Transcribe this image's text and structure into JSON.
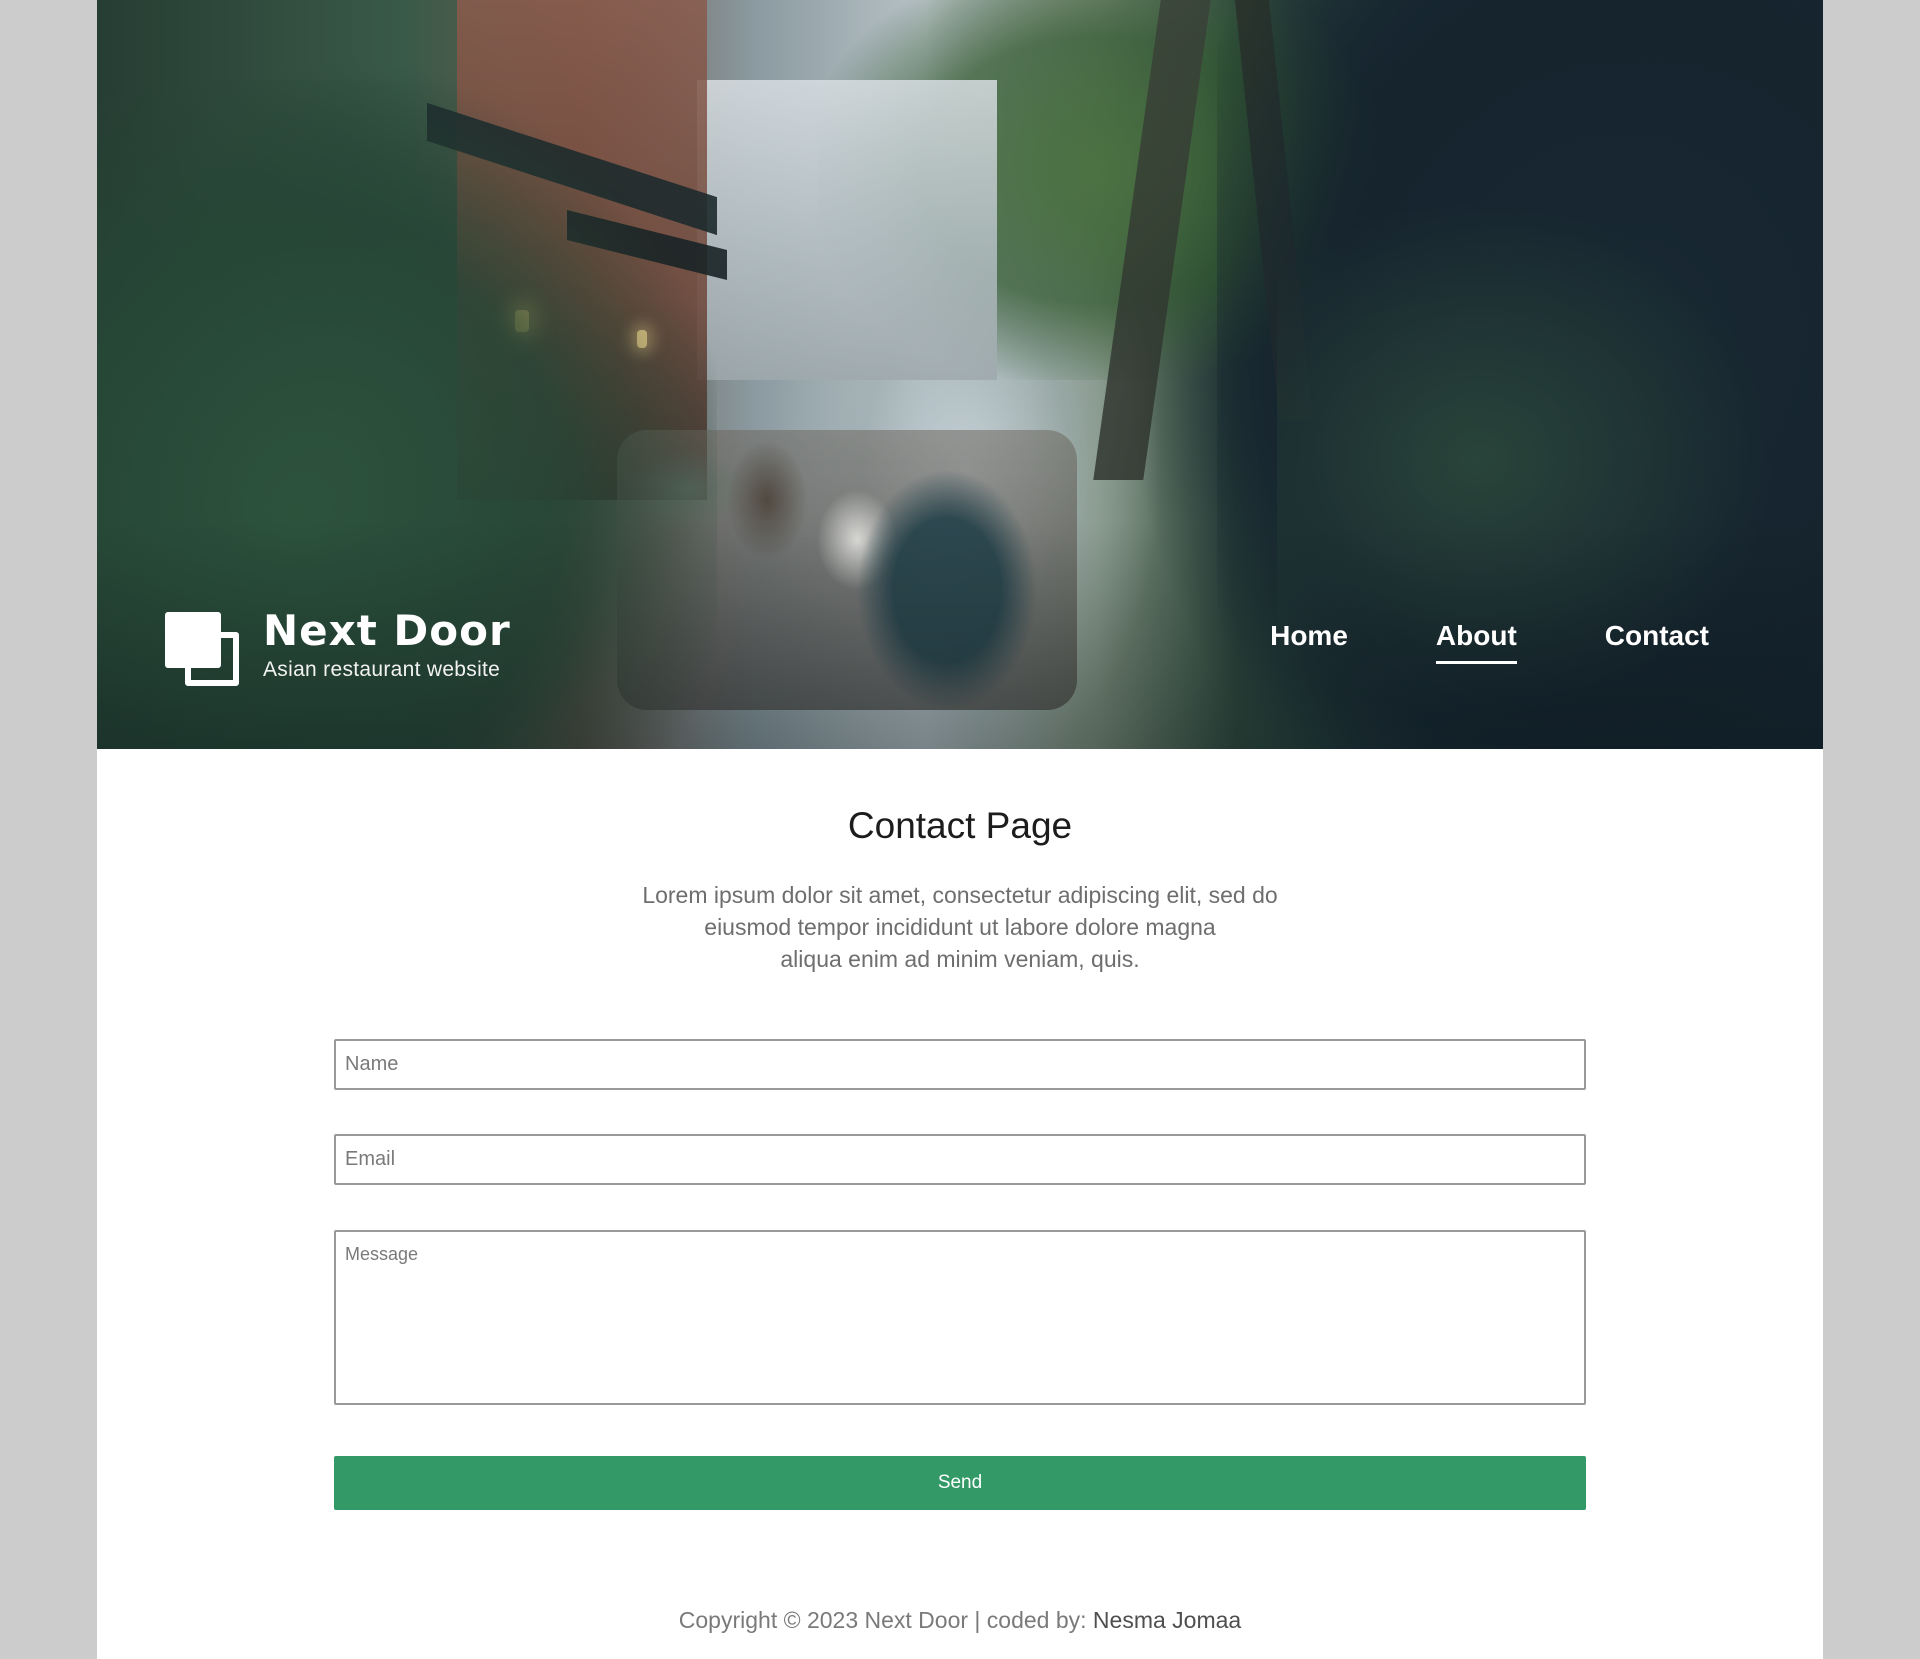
{
  "brand": {
    "title": "Next Door",
    "subtitle": "Asian restaurant website",
    "logo_icon": "overlapping-squares-icon"
  },
  "nav": {
    "items": [
      {
        "label": "Home",
        "active": false
      },
      {
        "label": "About",
        "active": true
      },
      {
        "label": "Contact",
        "active": false
      }
    ]
  },
  "main": {
    "title": "Contact Page",
    "intro_lines": [
      "Lorem ipsum dolor sit amet, consectetur adipiscing elit, sed do",
      "eiusmod tempor incididunt ut labore dolore magna",
      "aliqua enim ad minim veniam, quis."
    ]
  },
  "form": {
    "name_placeholder": "Name",
    "email_placeholder": "Email",
    "message_placeholder": "Message",
    "send_label": "Send"
  },
  "footer": {
    "text": "Copyright © 2023 Next Door | coded by:",
    "author": "Nesma Jomaa"
  },
  "colors": {
    "page_background": "#cccccc",
    "accent_button": "#339966",
    "nav_text": "#ffffff"
  }
}
